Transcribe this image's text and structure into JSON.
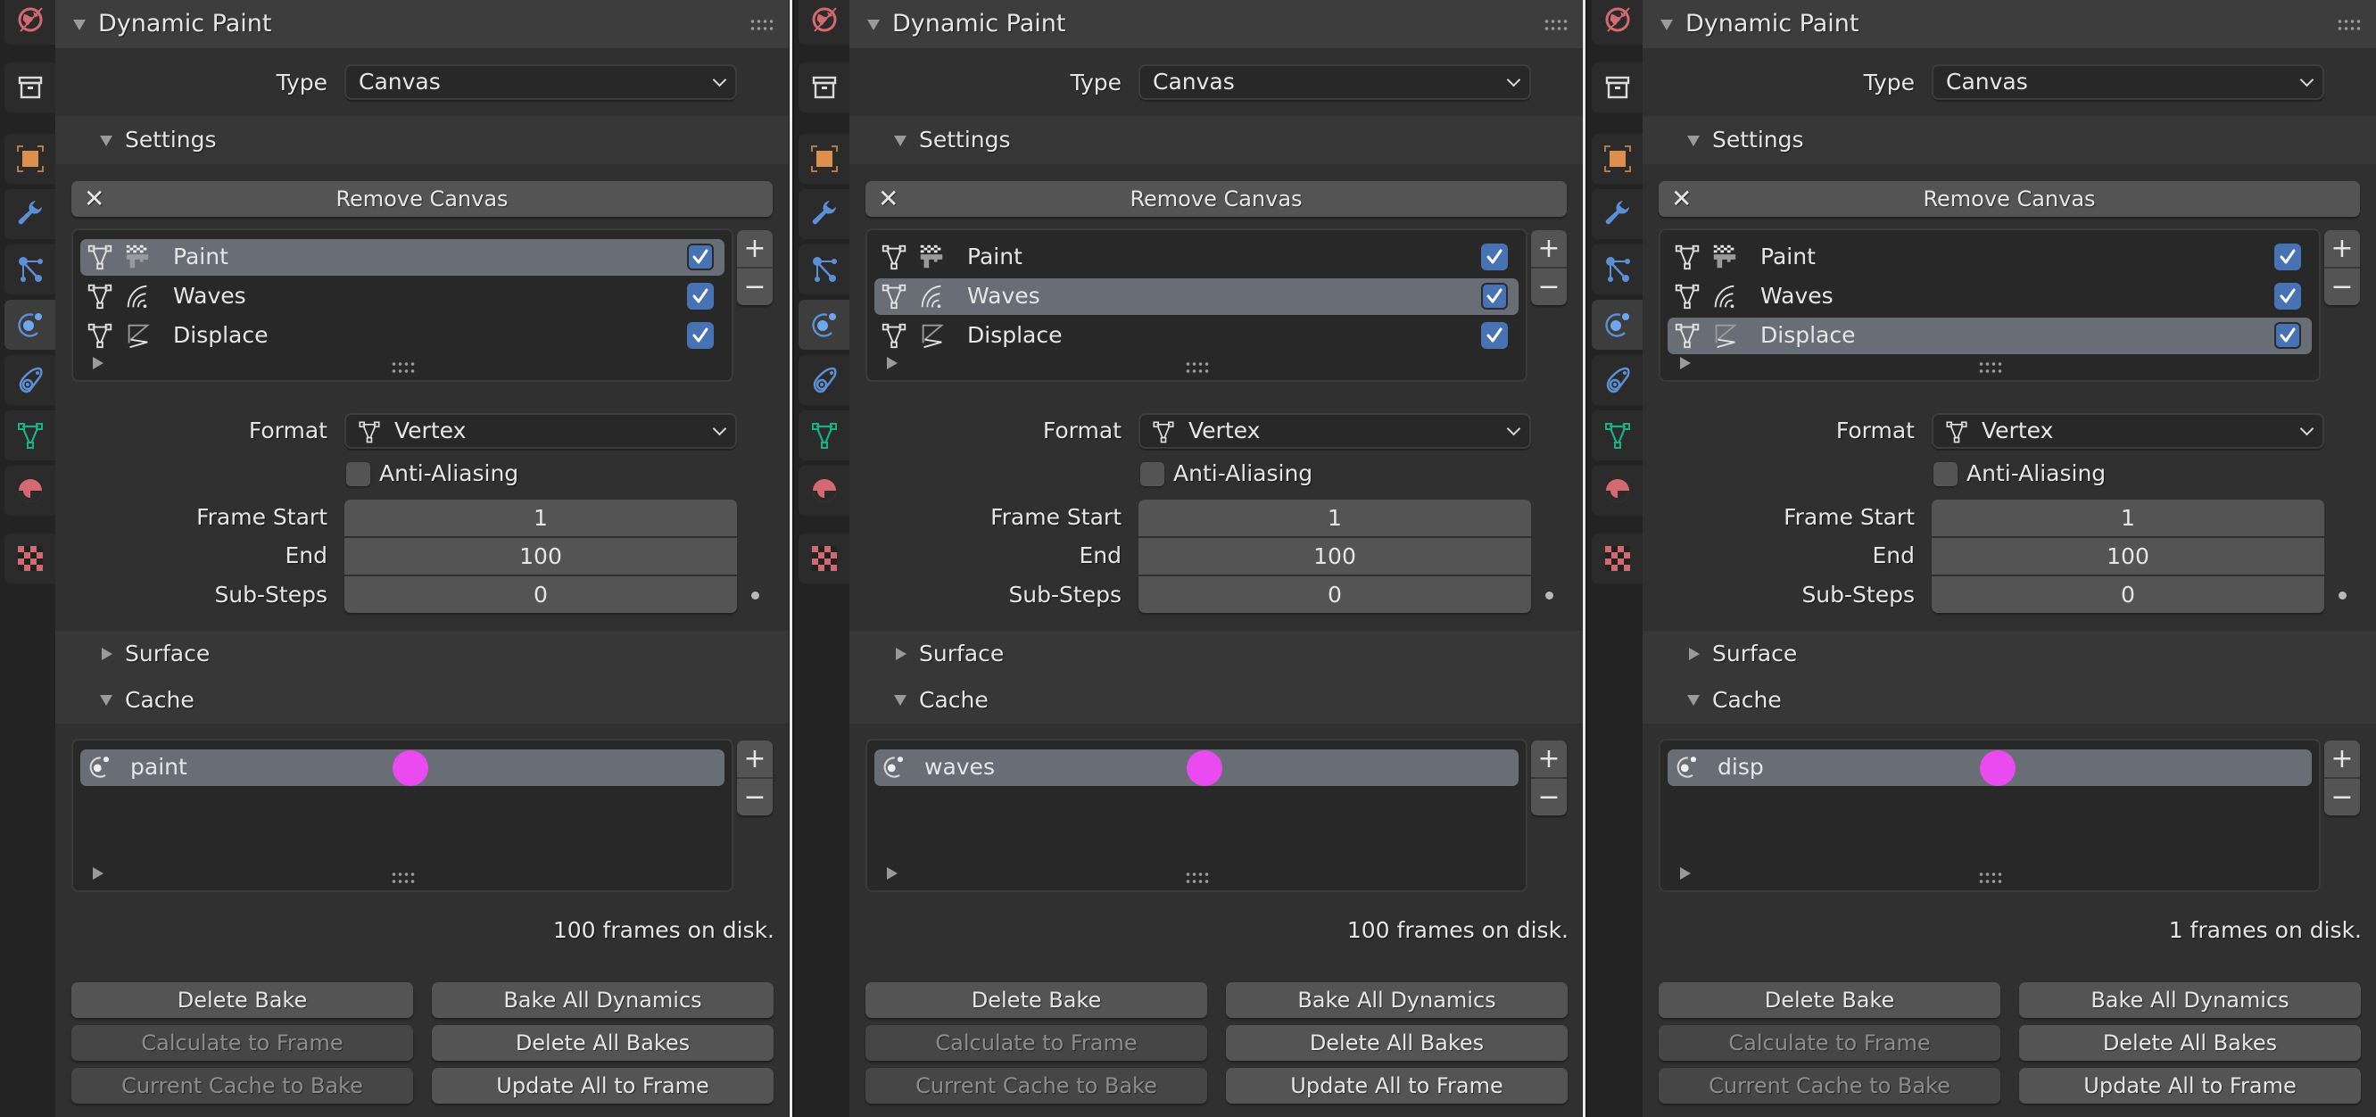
{
  "panels": [
    {
      "header": {
        "title": "Dynamic Paint"
      },
      "type_field": {
        "label": "Type",
        "value": "Canvas"
      },
      "settings": {
        "title": "Settings",
        "remove_button": "Remove Canvas",
        "surfaces": [
          {
            "name": "Paint",
            "icon": "paint-drip-icon",
            "enabled": true,
            "selected": true
          },
          {
            "name": "Waves",
            "icon": "waves-icon",
            "enabled": true,
            "selected": false
          },
          {
            "name": "Displace",
            "icon": "displace-icon",
            "enabled": true,
            "selected": false
          }
        ],
        "format": {
          "label": "Format",
          "value": "Vertex"
        },
        "anti_aliasing": {
          "label": "Anti-Aliasing",
          "checked": false
        },
        "frame_start": {
          "label": "Frame Start",
          "value": "1"
        },
        "frame_end": {
          "label": "End",
          "value": "100"
        },
        "sub_steps": {
          "label": "Sub-Steps",
          "value": "0"
        }
      },
      "surface_section": {
        "title": "Surface"
      },
      "cache": {
        "title": "Cache",
        "item": "paint",
        "status": "100 frames on disk.",
        "buttons": {
          "delete_bake": "Delete Bake",
          "bake_all": "Bake All Dynamics",
          "calc_to_frame": "Calculate to Frame",
          "delete_all": "Delete All Bakes",
          "current_to_bake": "Current Cache to Bake",
          "update_all": "Update All to Frame"
        }
      }
    },
    {
      "header": {
        "title": "Dynamic Paint"
      },
      "type_field": {
        "label": "Type",
        "value": "Canvas"
      },
      "settings": {
        "title": "Settings",
        "remove_button": "Remove Canvas",
        "surfaces": [
          {
            "name": "Paint",
            "icon": "paint-drip-icon",
            "enabled": true,
            "selected": false
          },
          {
            "name": "Waves",
            "icon": "waves-icon",
            "enabled": true,
            "selected": true
          },
          {
            "name": "Displace",
            "icon": "displace-icon",
            "enabled": true,
            "selected": false
          }
        ],
        "format": {
          "label": "Format",
          "value": "Vertex"
        },
        "anti_aliasing": {
          "label": "Anti-Aliasing",
          "checked": false
        },
        "frame_start": {
          "label": "Frame Start",
          "value": "1"
        },
        "frame_end": {
          "label": "End",
          "value": "100"
        },
        "sub_steps": {
          "label": "Sub-Steps",
          "value": "0"
        }
      },
      "surface_section": {
        "title": "Surface"
      },
      "cache": {
        "title": "Cache",
        "item": "waves",
        "status": "100 frames on disk.",
        "buttons": {
          "delete_bake": "Delete Bake",
          "bake_all": "Bake All Dynamics",
          "calc_to_frame": "Calculate to Frame",
          "delete_all": "Delete All Bakes",
          "current_to_bake": "Current Cache to Bake",
          "update_all": "Update All to Frame"
        }
      }
    },
    {
      "header": {
        "title": "Dynamic Paint"
      },
      "type_field": {
        "label": "Type",
        "value": "Canvas"
      },
      "settings": {
        "title": "Settings",
        "remove_button": "Remove Canvas",
        "surfaces": [
          {
            "name": "Paint",
            "icon": "paint-drip-icon",
            "enabled": true,
            "selected": false
          },
          {
            "name": "Waves",
            "icon": "waves-icon",
            "enabled": true,
            "selected": false
          },
          {
            "name": "Displace",
            "icon": "displace-icon",
            "enabled": true,
            "selected": true
          }
        ],
        "format": {
          "label": "Format",
          "value": "Vertex"
        },
        "anti_aliasing": {
          "label": "Anti-Aliasing",
          "checked": false
        },
        "frame_start": {
          "label": "Frame Start",
          "value": "1"
        },
        "frame_end": {
          "label": "End",
          "value": "100"
        },
        "sub_steps": {
          "label": "Sub-Steps",
          "value": "0"
        }
      },
      "surface_section": {
        "title": "Surface"
      },
      "cache": {
        "title": "Cache",
        "item": "disp",
        "status": "1 frames on disk.",
        "buttons": {
          "delete_bake": "Delete Bake",
          "bake_all": "Bake All Dynamics",
          "calc_to_frame": "Calculate to Frame",
          "delete_all": "Delete All Bakes",
          "current_to_bake": "Current Cache to Bake",
          "update_all": "Update All to Frame"
        }
      }
    }
  ],
  "sidebar_tabs": [
    {
      "name": "world",
      "icon": "world-icon",
      "active": false
    },
    {
      "name": "collection",
      "icon": "collection-box-icon",
      "active": false
    },
    {
      "name": "object",
      "icon": "object-icon",
      "active": false
    },
    {
      "name": "modifiers",
      "icon": "wrench-icon",
      "active": false
    },
    {
      "name": "particles",
      "icon": "particles-icon",
      "active": false
    },
    {
      "name": "physics",
      "icon": "physics-icon",
      "active": true
    },
    {
      "name": "constraints",
      "icon": "constraints-icon",
      "active": false
    },
    {
      "name": "data",
      "icon": "mesh-data-icon",
      "active": false
    },
    {
      "name": "material",
      "icon": "material-icon",
      "active": false
    },
    {
      "name": "texture",
      "icon": "texture-icon",
      "active": false
    }
  ],
  "colors": {
    "accent_checkbox": "#4772b3",
    "selected_row": "#696d75",
    "cache_marker": "#e94bf0"
  }
}
